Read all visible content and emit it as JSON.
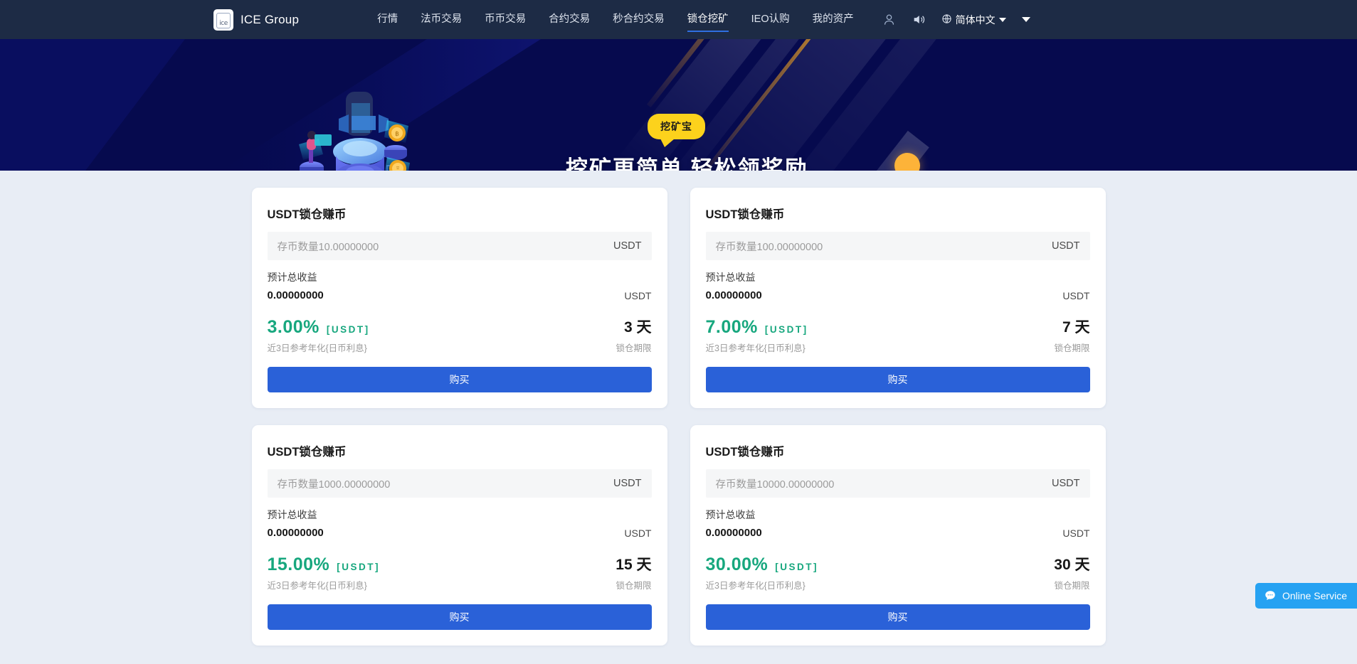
{
  "header": {
    "brand": {
      "logo_text": "ice",
      "name": "ICE Group"
    },
    "nav": [
      {
        "label": "行情",
        "active": false
      },
      {
        "label": "法币交易",
        "active": false
      },
      {
        "label": "币币交易",
        "active": false
      },
      {
        "label": "合约交易",
        "active": false
      },
      {
        "label": "秒合约交易",
        "active": false
      },
      {
        "label": "锁仓挖矿",
        "active": true
      },
      {
        "label": "IEO认购",
        "active": false
      },
      {
        "label": "我的资产",
        "active": false
      }
    ],
    "icons": {
      "user": "user-icon",
      "sound": "sound-icon",
      "globe": "globe-icon",
      "caret": "chevron-down-icon"
    },
    "language": "简体中文"
  },
  "banner": {
    "badge": "挖矿宝",
    "title": "挖矿更简单 轻松领奖励",
    "illustration": "mining-isometric-illustration",
    "accent_color": "#fcd21c",
    "bg_color": "#060a4e",
    "ball_color": "#fdb339"
  },
  "cards": [
    {
      "title": "USDT锁仓赚币",
      "amount_placeholder": "存币数量10.00000000",
      "amount_unit": "USDT",
      "return_label": "预计总收益",
      "return_value": "0.00000000",
      "return_unit": "USDT",
      "apy": "3.00%",
      "apy_coin": "[USDT]",
      "apy_sub": "近3日参考年化{日币利息}",
      "days": "3 天",
      "days_sub": "锁仓期限",
      "buy_label": "购买"
    },
    {
      "title": "USDT锁仓赚币",
      "amount_placeholder": "存币数量100.00000000",
      "amount_unit": "USDT",
      "return_label": "预计总收益",
      "return_value": "0.00000000",
      "return_unit": "USDT",
      "apy": "7.00%",
      "apy_coin": "[USDT]",
      "apy_sub": "近3日参考年化{日币利息}",
      "days": "7 天",
      "days_sub": "锁仓期限",
      "buy_label": "购买"
    },
    {
      "title": "USDT锁仓赚币",
      "amount_placeholder": "存币数量1000.00000000",
      "amount_unit": "USDT",
      "return_label": "预计总收益",
      "return_value": "0.00000000",
      "return_unit": "USDT",
      "apy": "15.00%",
      "apy_coin": "[USDT]",
      "apy_sub": "近3日参考年化{日币利息}",
      "days": "15 天",
      "days_sub": "锁仓期限",
      "buy_label": "购买"
    },
    {
      "title": "USDT锁仓赚币",
      "amount_placeholder": "存币数量10000.00000000",
      "amount_unit": "USDT",
      "return_label": "预计总收益",
      "return_value": "0.00000000",
      "return_unit": "USDT",
      "apy": "30.00%",
      "apy_coin": "[USDT]",
      "apy_sub": "近3日参考年化{日币利息}",
      "days": "30 天",
      "days_sub": "锁仓期限",
      "buy_label": "购买"
    }
  ],
  "online_service": {
    "label": "Online Service",
    "icon": "chat-bubble-icon",
    "color": "#26a2f2"
  }
}
